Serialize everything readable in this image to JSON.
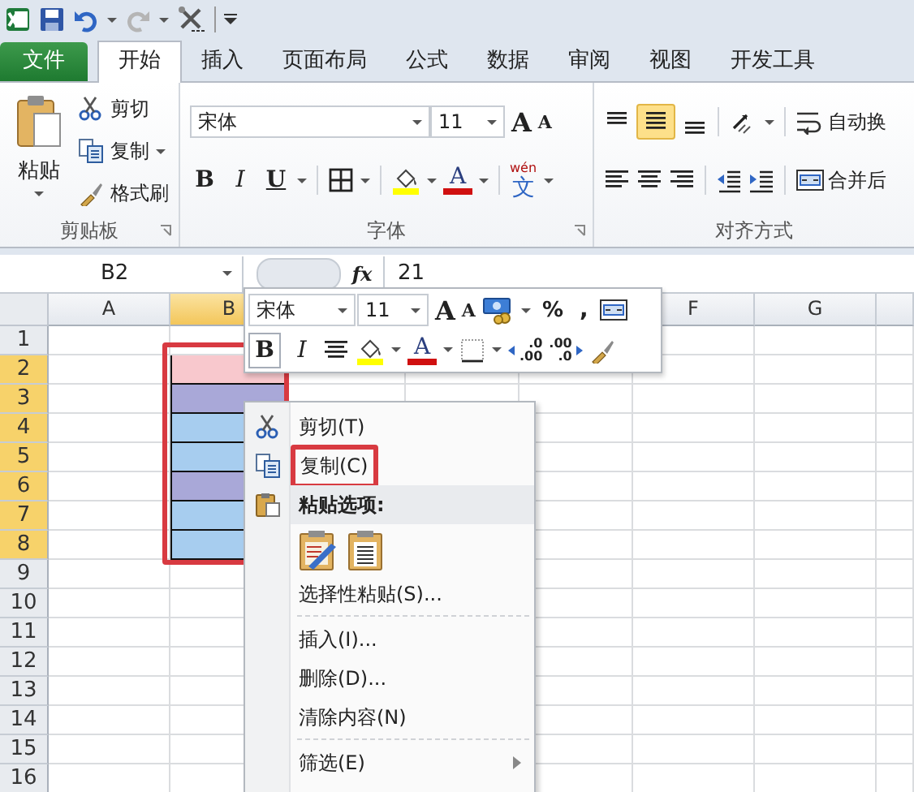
{
  "tabs": [
    {
      "label": "文件",
      "kind": "file",
      "selected": false
    },
    {
      "label": "开始",
      "kind": "tab",
      "selected": true
    },
    {
      "label": "插入",
      "kind": "tab",
      "selected": false
    },
    {
      "label": "页面布局",
      "kind": "tab",
      "selected": false
    },
    {
      "label": "公式",
      "kind": "tab",
      "selected": false
    },
    {
      "label": "数据",
      "kind": "tab",
      "selected": false
    },
    {
      "label": "审阅",
      "kind": "tab",
      "selected": false
    },
    {
      "label": "视图",
      "kind": "tab",
      "selected": false
    },
    {
      "label": "开发工具",
      "kind": "tab",
      "selected": false
    }
  ],
  "ribbon": {
    "clipboard": {
      "title": "剪贴板",
      "paste": "粘贴",
      "cut": "剪切",
      "copy": "复制",
      "format_painter": "格式刷"
    },
    "font": {
      "title": "字体",
      "font_name": "宋体",
      "font_size": "11",
      "grow": "A",
      "shrink": "A",
      "bold": "B",
      "italic": "I",
      "underline": "U",
      "font_color": "A",
      "phonetic_top": "wén",
      "phonetic": "文"
    },
    "alignment": {
      "title": "对齐方式",
      "wrap_text": "自动换",
      "merge": "合并后"
    }
  },
  "formula_bar": {
    "name_box": "B2",
    "fx": "fx",
    "value": "21"
  },
  "sheet": {
    "selection_highlighted": true,
    "columns": [
      {
        "label": "A",
        "selected": false
      },
      {
        "label": "B",
        "selected": true
      },
      null,
      null,
      null,
      {
        "label": "F",
        "selected": false
      },
      {
        "label": "G",
        "selected": false
      }
    ],
    "rows": [
      {
        "label": "1",
        "selected": false
      },
      {
        "label": "2",
        "selected": true,
        "cells": [
          null,
          {
            "color": "#f8c8cd"
          }
        ]
      },
      {
        "label": "3",
        "selected": true,
        "cells": [
          null,
          {
            "color": "#a9a8d8"
          }
        ]
      },
      {
        "label": "4",
        "selected": true,
        "cells": [
          null,
          {
            "color": "#a7cdef"
          }
        ]
      },
      {
        "label": "5",
        "selected": true,
        "cells": [
          null,
          {
            "color": "#a7cdef"
          }
        ]
      },
      {
        "label": "6",
        "selected": true,
        "cells": [
          null,
          {
            "color": "#a9a8d8"
          }
        ]
      },
      {
        "label": "7",
        "selected": true,
        "cells": [
          null,
          {
            "color": "#a7cdef"
          }
        ]
      },
      {
        "label": "8",
        "selected": true,
        "cells": [
          null,
          {
            "color": "#a7cdef"
          }
        ]
      },
      {
        "label": "9",
        "selected": false
      },
      {
        "label": "10",
        "selected": false
      },
      {
        "label": "11",
        "selected": false
      },
      {
        "label": "12",
        "selected": false
      },
      {
        "label": "13",
        "selected": false
      },
      {
        "label": "14",
        "selected": false
      },
      {
        "label": "15",
        "selected": false
      },
      {
        "label": "16",
        "selected": false
      }
    ]
  },
  "mini_toolbar": {
    "font_name": "宋体",
    "font_size": "11",
    "grow": "A",
    "shrink": "A",
    "percent": "%",
    "comma": ",",
    "bold": "B",
    "italic": "I",
    "font_color": "A",
    "increase_decimal": [
      ".0",
      ".00"
    ],
    "decrease_decimal": [
      ".00",
      ".0"
    ]
  },
  "context_menu": {
    "items": [
      {
        "kind": "cut",
        "label": "剪切(T)",
        "highlighted": false
      },
      {
        "kind": "copy",
        "label": "复制(C)",
        "highlighted": true
      },
      {
        "kind": "paste_header",
        "label": "粘贴选项:",
        "highlighted": false
      },
      {
        "kind": "paste_buttons"
      },
      {
        "kind": "item",
        "label": "选择性粘贴(S)...",
        "highlighted": false
      },
      {
        "kind": "separator"
      },
      {
        "kind": "item",
        "label": "插入(I)...",
        "highlighted": false
      },
      {
        "kind": "item",
        "label": "删除(D)...",
        "highlighted": false
      },
      {
        "kind": "item",
        "label": "清除内容(N)",
        "highlighted": false
      },
      {
        "kind": "separator"
      },
      {
        "kind": "submenu",
        "label": "筛选(E)",
        "highlighted": false
      }
    ]
  }
}
